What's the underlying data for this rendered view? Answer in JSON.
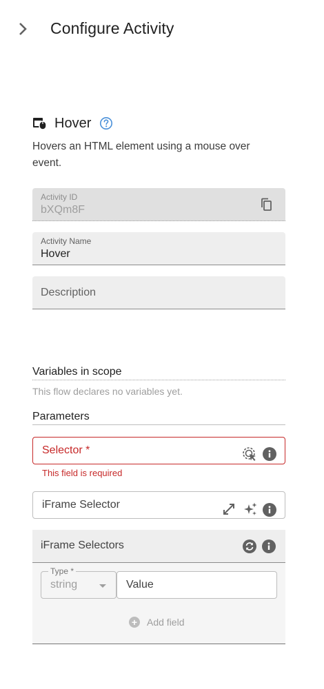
{
  "header": {
    "title": "Configure Activity"
  },
  "activity": {
    "name": "Hover",
    "description": "Hovers an HTML element using a mouse over event."
  },
  "fields": {
    "activity_id": {
      "label": "Activity ID",
      "value": "bXQm8F"
    },
    "activity_name": {
      "label": "Activity Name",
      "value": "Hover"
    },
    "description": {
      "placeholder": "Description"
    }
  },
  "variables": {
    "title": "Variables in scope",
    "note": "This flow declares no variables yet."
  },
  "parameters": {
    "title": "Parameters",
    "selector": {
      "label": "Selector *",
      "error": "This field is required"
    },
    "iframe_selector": {
      "label": "iFrame Selector"
    },
    "iframe_selectors": {
      "label": "iFrame Selectors",
      "type_label": "Type *",
      "type_value": "string",
      "value_placeholder": "Value",
      "add_field": "Add field"
    }
  },
  "colors": {
    "error": "#c62828",
    "help": "#4a90d9"
  }
}
